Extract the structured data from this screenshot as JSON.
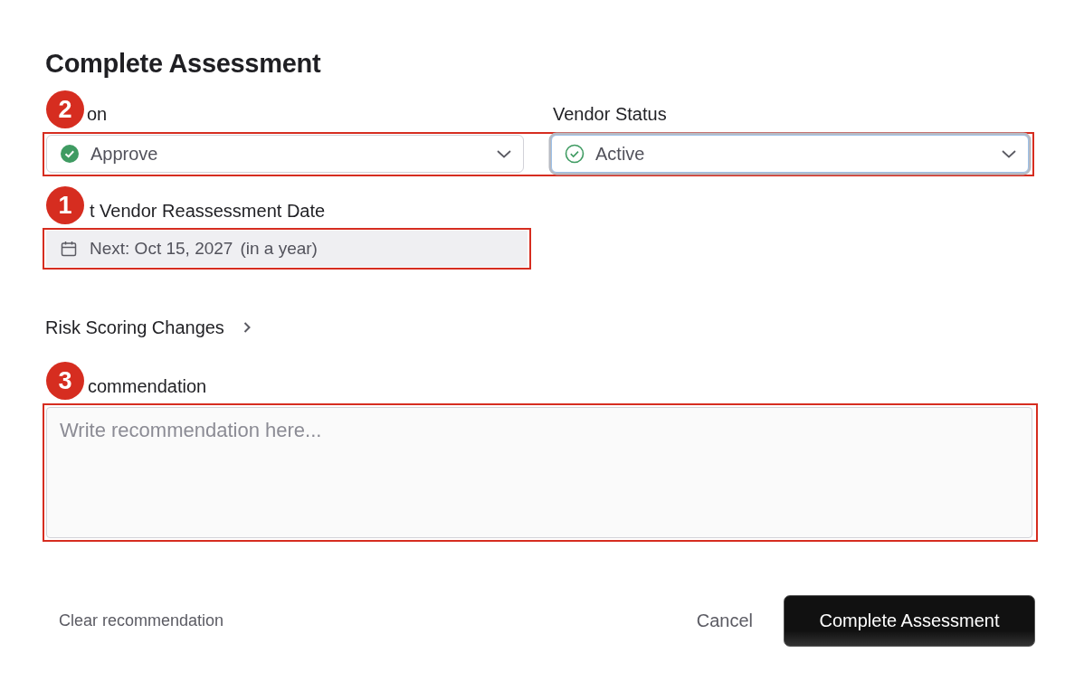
{
  "title": "Complete Assessment",
  "action": {
    "label": "on",
    "value": "Approve",
    "focused": false,
    "marker": "2"
  },
  "vendor_status": {
    "label": "Vendor Status",
    "value": "Active",
    "focused": true
  },
  "reassessment": {
    "label": "t Vendor Reassessment Date",
    "value": "Next: Oct 15, 2027",
    "relative": "(in a year)",
    "marker": "1"
  },
  "risk_scoring": {
    "label": "Risk Scoring Changes",
    "expanded": false
  },
  "recommendation": {
    "label": "commendation",
    "placeholder": "Write recommendation here...",
    "marker": "3"
  },
  "footer": {
    "clear": "Clear recommendation",
    "cancel": "Cancel",
    "submit": "Complete Assessment"
  }
}
